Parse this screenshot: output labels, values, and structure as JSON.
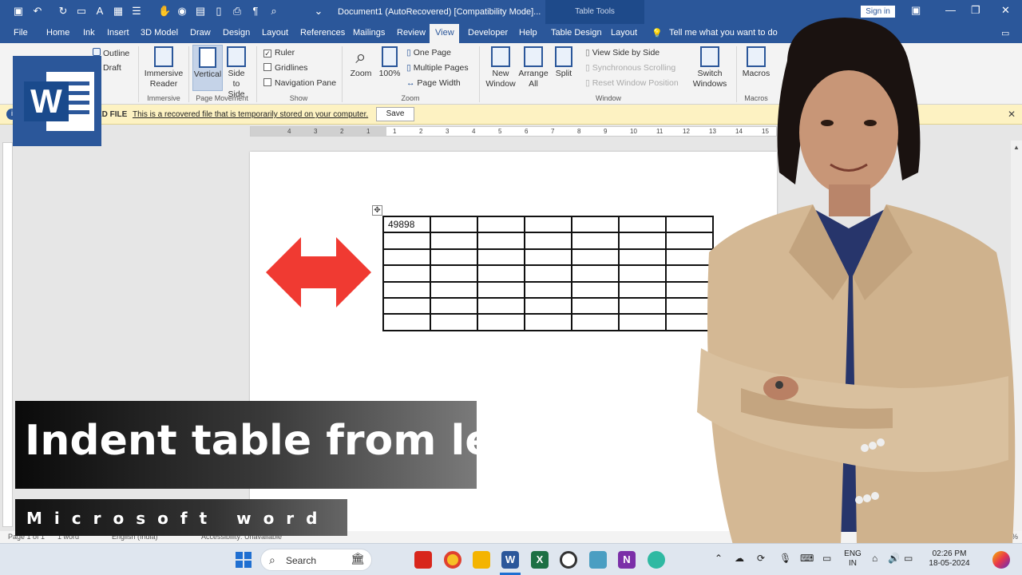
{
  "titlebar": {
    "doc_title": "Document1 (AutoRecovered) [Compatibility Mode]...",
    "context_group": "Table Tools",
    "sign_in": "Sign in"
  },
  "tabs": [
    "File",
    "Home",
    "Ink",
    "Insert",
    "3D Model",
    "Draw",
    "Design",
    "Layout",
    "References",
    "Mailings",
    "Review",
    "View",
    "Developer",
    "Help",
    "Table Design",
    "Layout"
  ],
  "active_tab": "View",
  "tell_me": "Tell me what you want to do",
  "ribbon": {
    "views": {
      "outline": "Outline",
      "draft": "Draft"
    },
    "immersive": {
      "reader_l1": "Immersive",
      "reader_l2": "Reader",
      "group": "Immersive"
    },
    "page_movement": {
      "vertical": "Vertical",
      "side_l1": "Side",
      "side_l2": "to Side",
      "group": "Page Movement"
    },
    "show": {
      "ruler": "Ruler",
      "gridlines": "Gridlines",
      "nav_pane": "Navigation Pane",
      "group": "Show"
    },
    "zoom": {
      "zoom": "Zoom",
      "hundred": "100%",
      "one_page": "One Page",
      "multiple_pages": "Multiple Pages",
      "page_width": "Page Width",
      "group": "Zoom"
    },
    "window": {
      "new_l1": "New",
      "new_l2": "Window",
      "arrange_l1": "Arrange",
      "arrange_l2": "All",
      "split": "Split",
      "side_by_side": "View Side by Side",
      "sync_scroll": "Synchronous Scrolling",
      "reset_pos": "Reset Window Position",
      "switch_l1": "Switch",
      "switch_l2": "Windows",
      "group": "Window"
    },
    "macros": {
      "macros": "Macros",
      "group": "Macros"
    }
  },
  "message_bar": {
    "lead": "ED FILE",
    "text": "This is a recovered file that is temporarily stored on your computer.",
    "save": "Save"
  },
  "ruler_marks": [
    "4",
    "3",
    "2",
    "1",
    "1",
    "2",
    "3",
    "4",
    "5",
    "6",
    "7",
    "8",
    "9",
    "10",
    "11",
    "12",
    "13",
    "14",
    "15"
  ],
  "table": {
    "rows": [
      [
        "49898",
        "",
        "",
        "",
        "",
        "",
        ""
      ],
      [
        "",
        "",
        "",
        "",
        "",
        "",
        ""
      ],
      [
        "",
        "",
        "",
        "",
        "",
        "",
        ""
      ],
      [
        "",
        "",
        "",
        "",
        "",
        "",
        ""
      ],
      [
        "",
        "",
        "",
        "",
        "",
        "",
        ""
      ],
      [
        "",
        "",
        "",
        "",
        "",
        "",
        ""
      ],
      [
        "",
        "",
        "",
        "",
        "",
        "",
        ""
      ]
    ]
  },
  "status": {
    "page": "Page 1 of 1",
    "words": "1 word",
    "language": "English (India)",
    "accessibility": "Accessibility: Unavailable",
    "zoom": "100%"
  },
  "overlay": {
    "headline": "Indent table from left",
    "subline": "Microsoft word"
  },
  "taskbar": {
    "search": "Search",
    "lang_l1": "ENG",
    "lang_l2": "IN",
    "time": "02:26 PM",
    "date": "18-05-2024"
  },
  "colors": {
    "word_blue": "#2b579a",
    "arrow_red": "#f03a32",
    "msg_bar": "#fdf2c2"
  }
}
